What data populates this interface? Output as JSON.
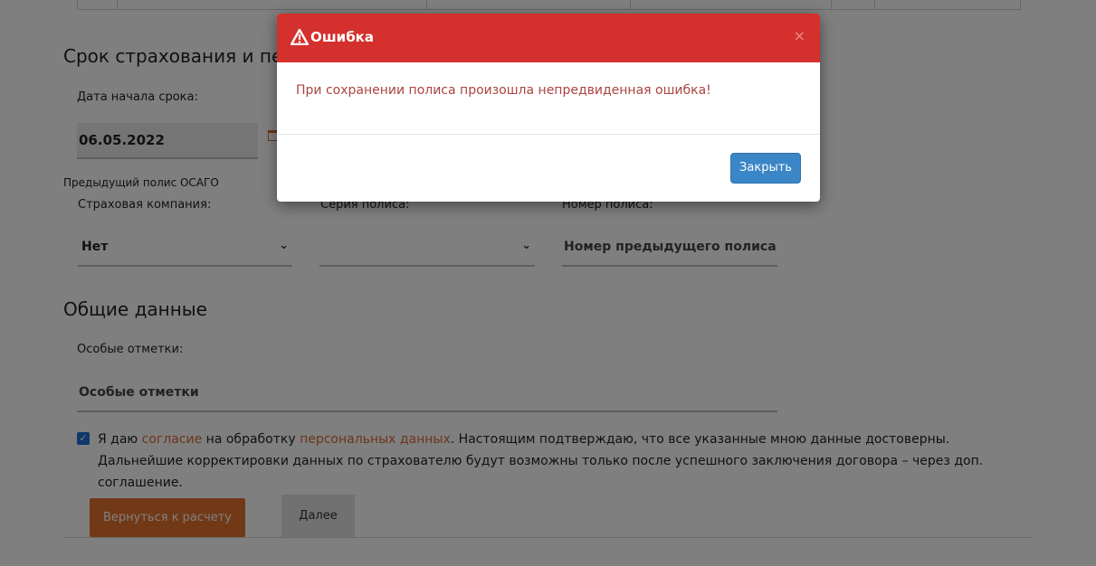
{
  "term": {
    "title": "Срок страхования и период",
    "start_date_label": "Дата начала срока:",
    "start_date_value": "06.05.2022"
  },
  "previous_policy": {
    "title": "Предыдущий полис ОСАГО",
    "company_label": "Страховая компания:",
    "company_value": "Нет",
    "series_label": "Серия полиса:",
    "series_value": "",
    "number_label": "Номер полиса:",
    "number_placeholder": "Номер предыдущего полиса ОСАГО"
  },
  "general": {
    "title": "Общие данные",
    "notes_label": "Особые отметки:",
    "notes_placeholder": "Особые отметки"
  },
  "consent": {
    "checked": true,
    "part1": "Я даю ",
    "link1": "согласие",
    "part2": " на обработку ",
    "link2": "персональных данных",
    "part3": ". Настоящим подтверждаю, что все указанные мною данные достоверны. Дальнейшие корректировки данных по страхователю будут возможны только после успешного заключения договора – через доп. соглашение."
  },
  "buttons": {
    "back": "Вернуться к расчету",
    "next": "Далее"
  },
  "modal": {
    "title": "Ошибка",
    "close_symbol": "×",
    "message": "При сохранении полиса произошла непредвиденная ошибка!",
    "close_button": "Закрыть"
  },
  "colors": {
    "modal_header": "#d4302e",
    "error_text": "#a94442",
    "primary_button": "#3a86c7",
    "accent": "#e5722f"
  }
}
